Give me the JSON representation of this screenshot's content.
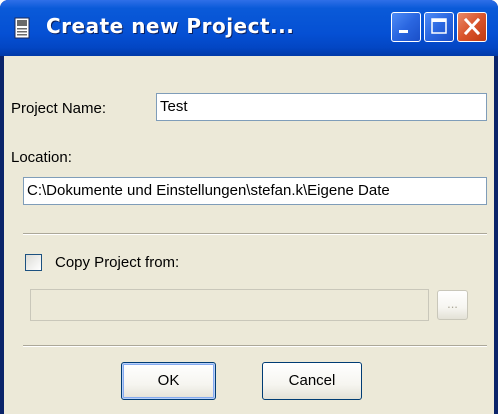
{
  "window": {
    "title": "Create new Project..."
  },
  "form": {
    "project_name_label": "Project Name:",
    "project_name_value": "Test",
    "location_label": "Location:",
    "location_value": "C:\\Dokumente und Einstellungen\\stefan.k\\Eigene Date",
    "copy_project_label": "Copy Project from:",
    "copy_project_checked": false,
    "copy_project_value": "",
    "browse_label": "..."
  },
  "buttons": {
    "ok_label": "OK",
    "cancel_label": "Cancel"
  },
  "icons": {
    "title_icon": "document-icon",
    "minimize": "minimize-icon",
    "maximize": "maximize-icon",
    "close": "close-icon"
  },
  "colors": {
    "titlebar": "#0550d4",
    "dialog_background": "#ece9d8",
    "close_button": "#d9542c"
  }
}
